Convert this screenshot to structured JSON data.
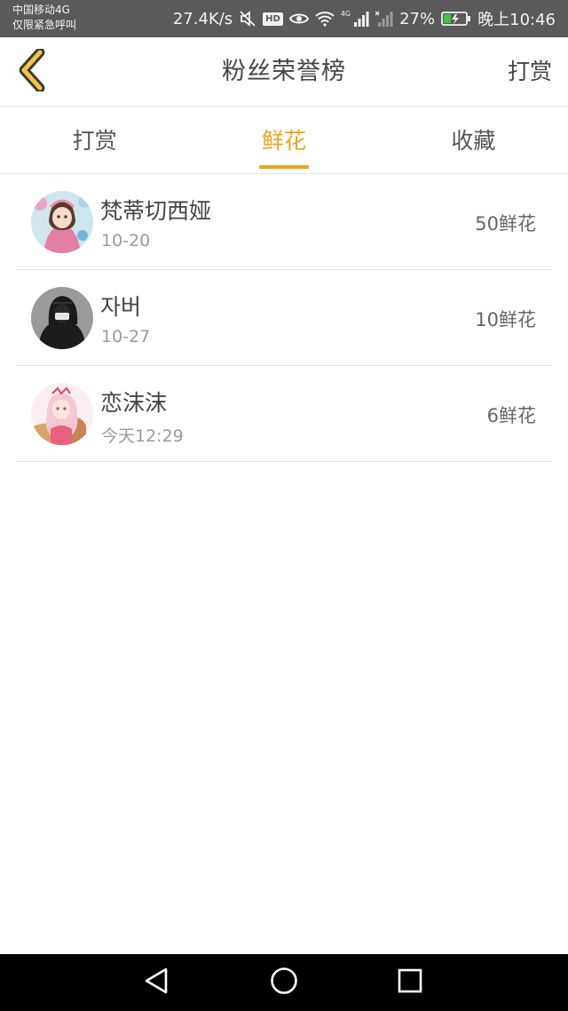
{
  "status_bar": {
    "carrier_line1": "中国移动4G",
    "carrier_line2": "仅限紧急呼叫",
    "net_speed": "27.4K/s",
    "hd_label": "HD",
    "network_type": "4G",
    "battery_percent": "27%",
    "time": "晚上10:46"
  },
  "header": {
    "title": "粉丝荣誉榜",
    "action_label": "打赏",
    "accent_color": "#f2a21a"
  },
  "tabs": [
    {
      "label": "打赏",
      "active": false
    },
    {
      "label": "鲜花",
      "active": true
    },
    {
      "label": "收藏",
      "active": false
    }
  ],
  "list": [
    {
      "name": "梵蒂切西娅",
      "date": "10-20",
      "amount": "50鲜花",
      "avatar": "anime-girl-avatar"
    },
    {
      "name": "자버",
      "date": "10-27",
      "amount": "10鲜花",
      "avatar": "dark-hooded-avatar"
    },
    {
      "name": "恋沫沫",
      "date": "今天12:29",
      "amount": "6鲜花",
      "avatar": "pink-hair-girl-avatar"
    }
  ],
  "nav_bar": {
    "icons": [
      "back-triangle-icon",
      "home-circle-icon",
      "recents-square-icon"
    ]
  }
}
